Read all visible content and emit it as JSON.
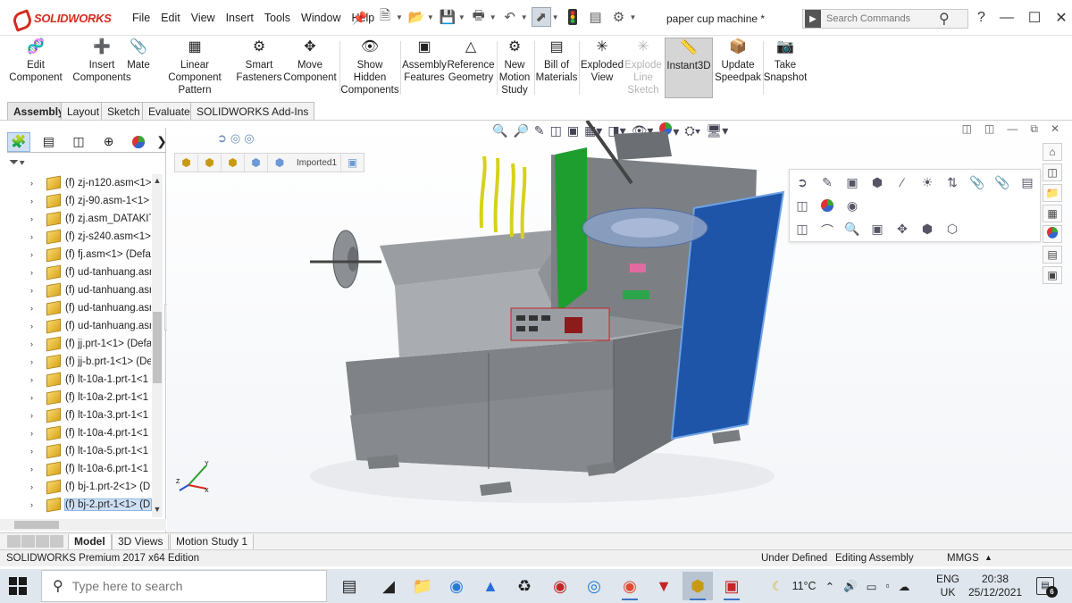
{
  "app": {
    "brand": "SOLIDWORKS",
    "document_title": "paper cup machine *"
  },
  "menu": [
    "File",
    "Edit",
    "View",
    "Insert",
    "Tools",
    "Window",
    "Help"
  ],
  "search": {
    "placeholder": "Search Commands"
  },
  "command_manager": [
    {
      "label": "Edit\nComponent",
      "icon": "edit-component-icon",
      "enabled": true
    },
    {
      "label": "Insert\nComponents",
      "icon": "insert-components-icon",
      "enabled": true
    },
    {
      "label": "Mate",
      "icon": "mate-icon",
      "enabled": true
    },
    {
      "label": "Linear Component\nPattern",
      "icon": "linear-pattern-icon",
      "enabled": true
    },
    {
      "label": "Smart\nFasteners",
      "icon": "smart-fasteners-icon",
      "enabled": true
    },
    {
      "label": "Move\nComponent",
      "icon": "move-component-icon",
      "enabled": true
    },
    {
      "label": "Show\nHidden\nComponents",
      "icon": "show-hidden-icon",
      "enabled": true
    },
    {
      "label": "Assembly\nFeatures",
      "icon": "assembly-features-icon",
      "enabled": true
    },
    {
      "label": "Reference\nGeometry",
      "icon": "reference-geometry-icon",
      "enabled": true
    },
    {
      "label": "New\nMotion\nStudy",
      "icon": "motion-study-icon",
      "enabled": true
    },
    {
      "label": "Bill of\nMaterials",
      "icon": "bom-icon",
      "enabled": true
    },
    {
      "label": "Exploded\nView",
      "icon": "exploded-view-icon",
      "enabled": true
    },
    {
      "label": "Explode\nLine\nSketch",
      "icon": "explode-line-icon",
      "enabled": false
    },
    {
      "label": "Instant3D",
      "icon": "instant3d-icon",
      "enabled": true,
      "active": true
    },
    {
      "label": "Update\nSpeedpak",
      "icon": "speedpak-icon",
      "enabled": true
    },
    {
      "label": "Take\nSnapshot",
      "icon": "camera-icon",
      "enabled": true
    }
  ],
  "tabs": [
    "Assembly",
    "Layout",
    "Sketch",
    "Evaluate",
    "SOLIDWORKS Add-Ins"
  ],
  "active_tab": "Assembly",
  "tree": [
    "(f) zj-n120.asm<1>",
    "(f) zj-90.asm-1<1>",
    "(f) zj.asm_DATAKIT_",
    "(f) zj-s240.asm<1>",
    "(f) fj.asm<1> (Defa",
    "(f) ud-tanhuang.asr",
    "(f) ud-tanhuang.asr",
    "(f) ud-tanhuang.asr",
    "(f) ud-tanhuang.asr",
    "(f) jj.prt-1<1> (Defa",
    "(f) jj-b.prt-1<1> (De",
    "(f) lt-10a-1.prt-1<1",
    "(f) lt-10a-2.prt-1<1",
    "(f) lt-10a-3.prt-1<1",
    "(f) lt-10a-4.prt-1<1",
    "(f) lt-10a-5.prt-1<1",
    "(f) lt-10a-6.prt-1<1",
    "(f) bj-1.prt-2<1> (D",
    "(f) bj-2.prt-1<1> (D"
  ],
  "selected_tree_item_index": 18,
  "breadcrumb_label": "Imported1",
  "bottom_tabs": [
    "Model",
    "3D Views",
    "Motion Study 1"
  ],
  "status": {
    "edition": "SOLIDWORKS Premium 2017 x64 Edition",
    "definition": "Under Defined",
    "mode": "Editing Assembly",
    "units": "MMGS"
  },
  "taskbar": {
    "search_placeholder": "Type here to search",
    "weather": "11°C",
    "language": "ENG",
    "region": "UK",
    "time": "20:38",
    "date": "25/12/2021",
    "notifications": "6"
  },
  "colors": {
    "accent": "#d52b1e",
    "selection": "#cfe0f5",
    "panel_blue": "#1f55a8",
    "machine_gray": "#8d8d8d"
  }
}
